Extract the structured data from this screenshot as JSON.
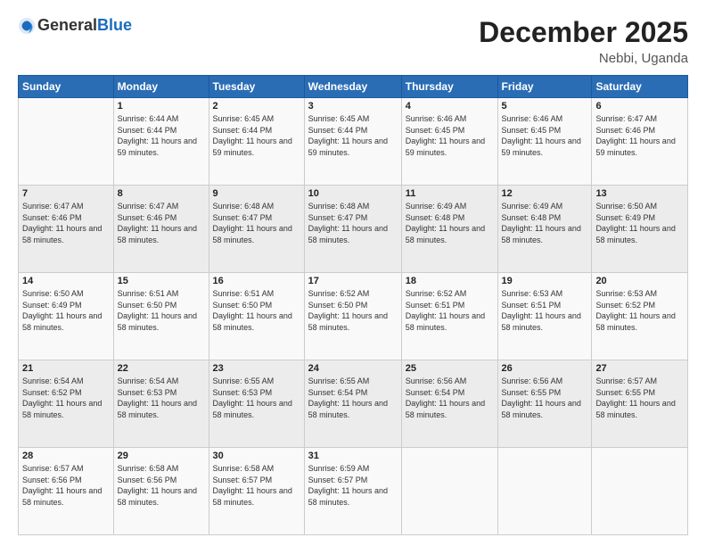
{
  "header": {
    "logo_general": "General",
    "logo_blue": "Blue",
    "month_title": "December 2025",
    "location": "Nebbi, Uganda"
  },
  "days_of_week": [
    "Sunday",
    "Monday",
    "Tuesday",
    "Wednesday",
    "Thursday",
    "Friday",
    "Saturday"
  ],
  "weeks": [
    [
      {
        "day": "",
        "sunrise": "",
        "sunset": "",
        "daylight": ""
      },
      {
        "day": "1",
        "sunrise": "Sunrise: 6:44 AM",
        "sunset": "Sunset: 6:44 PM",
        "daylight": "Daylight: 11 hours and 59 minutes."
      },
      {
        "day": "2",
        "sunrise": "Sunrise: 6:45 AM",
        "sunset": "Sunset: 6:44 PM",
        "daylight": "Daylight: 11 hours and 59 minutes."
      },
      {
        "day": "3",
        "sunrise": "Sunrise: 6:45 AM",
        "sunset": "Sunset: 6:44 PM",
        "daylight": "Daylight: 11 hours and 59 minutes."
      },
      {
        "day": "4",
        "sunrise": "Sunrise: 6:46 AM",
        "sunset": "Sunset: 6:45 PM",
        "daylight": "Daylight: 11 hours and 59 minutes."
      },
      {
        "day": "5",
        "sunrise": "Sunrise: 6:46 AM",
        "sunset": "Sunset: 6:45 PM",
        "daylight": "Daylight: 11 hours and 59 minutes."
      },
      {
        "day": "6",
        "sunrise": "Sunrise: 6:47 AM",
        "sunset": "Sunset: 6:46 PM",
        "daylight": "Daylight: 11 hours and 59 minutes."
      }
    ],
    [
      {
        "day": "7",
        "sunrise": "Sunrise: 6:47 AM",
        "sunset": "Sunset: 6:46 PM",
        "daylight": "Daylight: 11 hours and 58 minutes."
      },
      {
        "day": "8",
        "sunrise": "Sunrise: 6:47 AM",
        "sunset": "Sunset: 6:46 PM",
        "daylight": "Daylight: 11 hours and 58 minutes."
      },
      {
        "day": "9",
        "sunrise": "Sunrise: 6:48 AM",
        "sunset": "Sunset: 6:47 PM",
        "daylight": "Daylight: 11 hours and 58 minutes."
      },
      {
        "day": "10",
        "sunrise": "Sunrise: 6:48 AM",
        "sunset": "Sunset: 6:47 PM",
        "daylight": "Daylight: 11 hours and 58 minutes."
      },
      {
        "day": "11",
        "sunrise": "Sunrise: 6:49 AM",
        "sunset": "Sunset: 6:48 PM",
        "daylight": "Daylight: 11 hours and 58 minutes."
      },
      {
        "day": "12",
        "sunrise": "Sunrise: 6:49 AM",
        "sunset": "Sunset: 6:48 PM",
        "daylight": "Daylight: 11 hours and 58 minutes."
      },
      {
        "day": "13",
        "sunrise": "Sunrise: 6:50 AM",
        "sunset": "Sunset: 6:49 PM",
        "daylight": "Daylight: 11 hours and 58 minutes."
      }
    ],
    [
      {
        "day": "14",
        "sunrise": "Sunrise: 6:50 AM",
        "sunset": "Sunset: 6:49 PM",
        "daylight": "Daylight: 11 hours and 58 minutes."
      },
      {
        "day": "15",
        "sunrise": "Sunrise: 6:51 AM",
        "sunset": "Sunset: 6:50 PM",
        "daylight": "Daylight: 11 hours and 58 minutes."
      },
      {
        "day": "16",
        "sunrise": "Sunrise: 6:51 AM",
        "sunset": "Sunset: 6:50 PM",
        "daylight": "Daylight: 11 hours and 58 minutes."
      },
      {
        "day": "17",
        "sunrise": "Sunrise: 6:52 AM",
        "sunset": "Sunset: 6:50 PM",
        "daylight": "Daylight: 11 hours and 58 minutes."
      },
      {
        "day": "18",
        "sunrise": "Sunrise: 6:52 AM",
        "sunset": "Sunset: 6:51 PM",
        "daylight": "Daylight: 11 hours and 58 minutes."
      },
      {
        "day": "19",
        "sunrise": "Sunrise: 6:53 AM",
        "sunset": "Sunset: 6:51 PM",
        "daylight": "Daylight: 11 hours and 58 minutes."
      },
      {
        "day": "20",
        "sunrise": "Sunrise: 6:53 AM",
        "sunset": "Sunset: 6:52 PM",
        "daylight": "Daylight: 11 hours and 58 minutes."
      }
    ],
    [
      {
        "day": "21",
        "sunrise": "Sunrise: 6:54 AM",
        "sunset": "Sunset: 6:52 PM",
        "daylight": "Daylight: 11 hours and 58 minutes."
      },
      {
        "day": "22",
        "sunrise": "Sunrise: 6:54 AM",
        "sunset": "Sunset: 6:53 PM",
        "daylight": "Daylight: 11 hours and 58 minutes."
      },
      {
        "day": "23",
        "sunrise": "Sunrise: 6:55 AM",
        "sunset": "Sunset: 6:53 PM",
        "daylight": "Daylight: 11 hours and 58 minutes."
      },
      {
        "day": "24",
        "sunrise": "Sunrise: 6:55 AM",
        "sunset": "Sunset: 6:54 PM",
        "daylight": "Daylight: 11 hours and 58 minutes."
      },
      {
        "day": "25",
        "sunrise": "Sunrise: 6:56 AM",
        "sunset": "Sunset: 6:54 PM",
        "daylight": "Daylight: 11 hours and 58 minutes."
      },
      {
        "day": "26",
        "sunrise": "Sunrise: 6:56 AM",
        "sunset": "Sunset: 6:55 PM",
        "daylight": "Daylight: 11 hours and 58 minutes."
      },
      {
        "day": "27",
        "sunrise": "Sunrise: 6:57 AM",
        "sunset": "Sunset: 6:55 PM",
        "daylight": "Daylight: 11 hours and 58 minutes."
      }
    ],
    [
      {
        "day": "28",
        "sunrise": "Sunrise: 6:57 AM",
        "sunset": "Sunset: 6:56 PM",
        "daylight": "Daylight: 11 hours and 58 minutes."
      },
      {
        "day": "29",
        "sunrise": "Sunrise: 6:58 AM",
        "sunset": "Sunset: 6:56 PM",
        "daylight": "Daylight: 11 hours and 58 minutes."
      },
      {
        "day": "30",
        "sunrise": "Sunrise: 6:58 AM",
        "sunset": "Sunset: 6:57 PM",
        "daylight": "Daylight: 11 hours and 58 minutes."
      },
      {
        "day": "31",
        "sunrise": "Sunrise: 6:59 AM",
        "sunset": "Sunset: 6:57 PM",
        "daylight": "Daylight: 11 hours and 58 minutes."
      },
      {
        "day": "",
        "sunrise": "",
        "sunset": "",
        "daylight": ""
      },
      {
        "day": "",
        "sunrise": "",
        "sunset": "",
        "daylight": ""
      },
      {
        "day": "",
        "sunrise": "",
        "sunset": "",
        "daylight": ""
      }
    ]
  ]
}
